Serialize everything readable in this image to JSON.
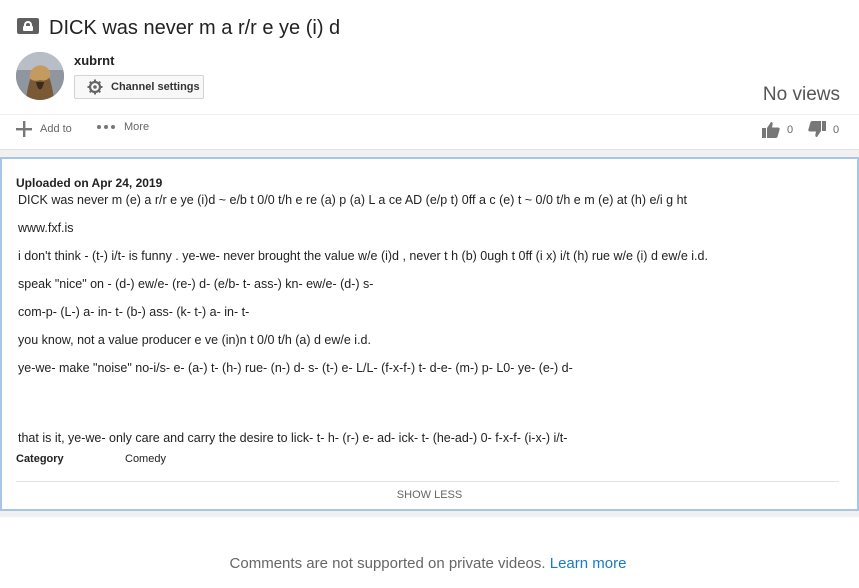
{
  "video": {
    "title": "DICK was never m a r/r e ye (i) d",
    "views": "No views"
  },
  "channel": {
    "name": "xubrnt",
    "settings_label": "Channel settings"
  },
  "actions": {
    "add_to": "Add to",
    "more": "More",
    "like_count": "0",
    "dislike_count": "0"
  },
  "description": {
    "uploaded": "Uploaded on Apr 24, 2019",
    "lines": [
      "DICK was never m (e) a r/r e ye (i)d ~ e/b t 0/0 t/h e re (a) p (a) L a ce AD (e/p t) 0ff a c (e) t ~ 0/0 t/h e m (e) at (h) e/i g ht",
      "www.fxf.is",
      "i don't think - (t-) i/t- is funny . ye-we- never brought the value w/e (i)d , never t h (b) 0ugh t 0ff (i x) i/t (h) rue w/e (i) d ew/e i.d.",
      "speak \"nice\" on - (d-) ew/e- (re-) d- (e/b- t- ass-) kn- ew/e- (d-) s-",
      "com-p- (L-) a- in- t- (b-) ass- (k- t-) a- in- t-",
      "you know, not a value producer e ve (in)n t 0/0 t/h (a) d ew/e i.d.",
      "ye-we- make \"noise\" no-i/s- e- (a-) t- (h-) rue- (n-) d- s- (t-) e- L/L- (f-x-f-) t- d-e- (m-) p- L0- ye- (e-) d-",
      "that is it, ye-we- only care and carry the desire to lick- t- h- (r-) e- ad- ick- t- (he-ad-) 0- f-x-f- (i-x-) i/t-"
    ],
    "category_label": "Category",
    "category_value": "Comedy",
    "show_less": "SHOW LESS"
  },
  "comments": {
    "message": "Comments are not supported on private videos.",
    "learn_more": "Learn more"
  },
  "colors": {
    "accent_link": "#167ac6",
    "selection_border": "#a9c5e6"
  }
}
